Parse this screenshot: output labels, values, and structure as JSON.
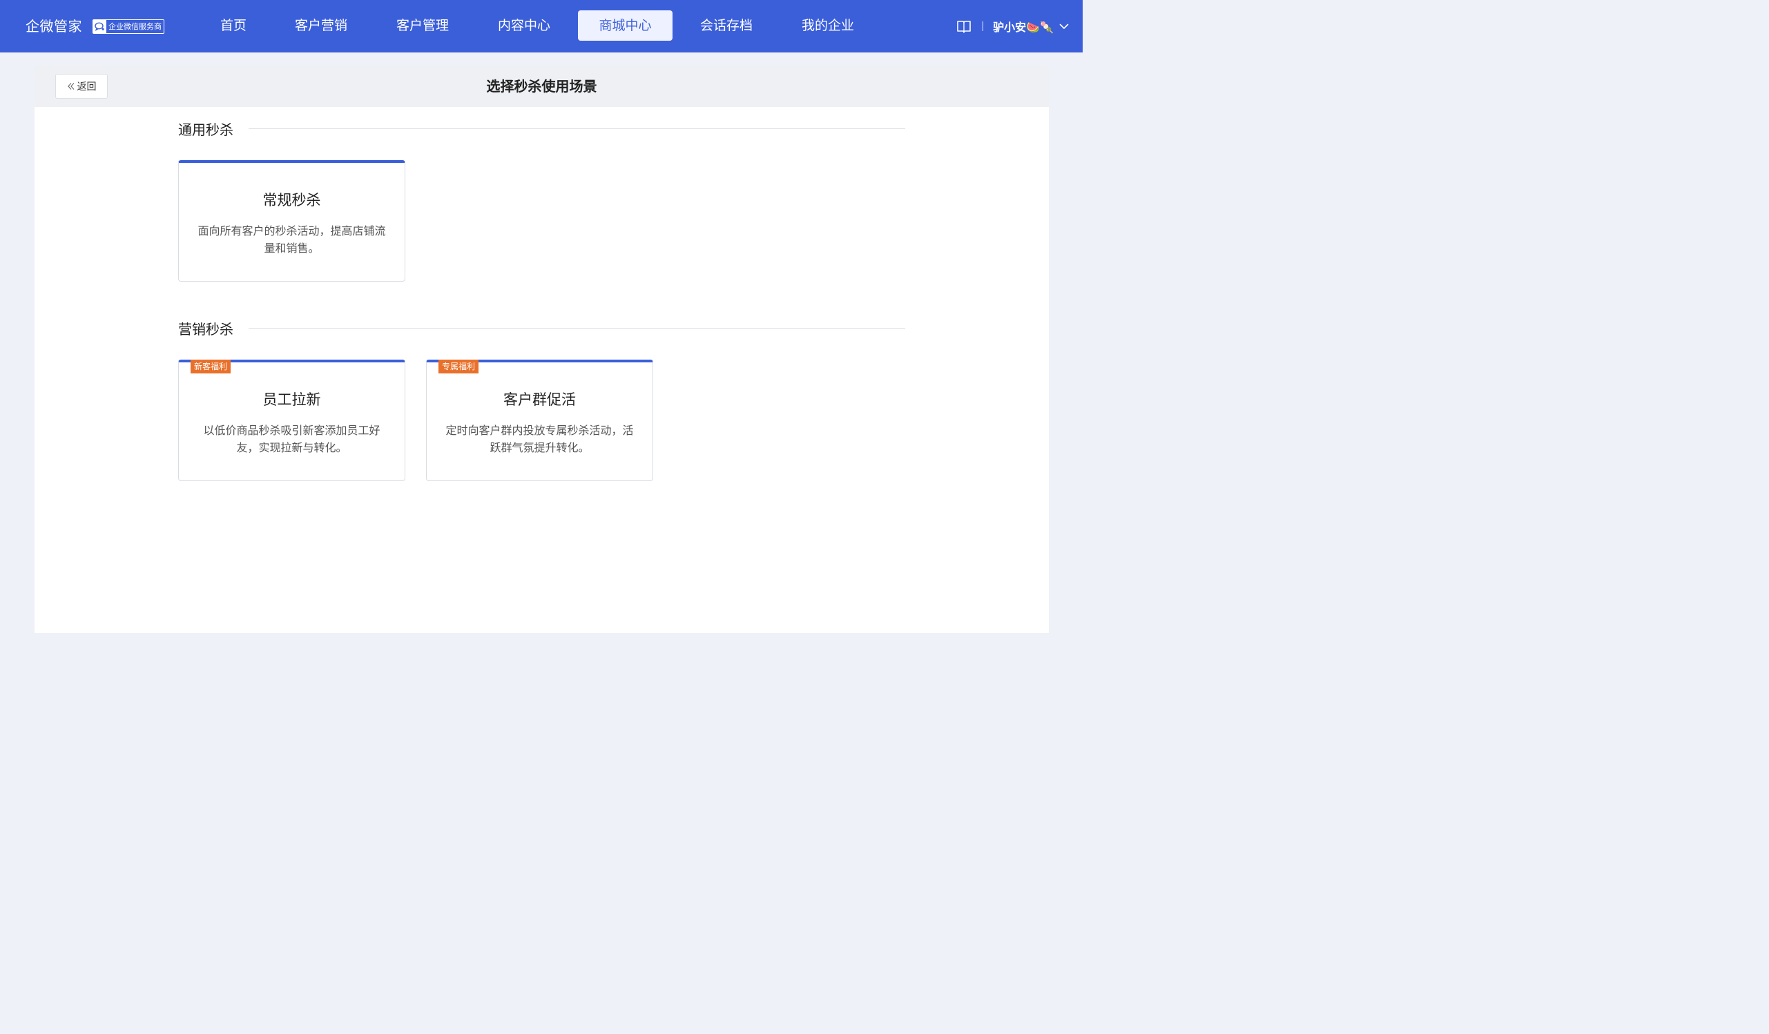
{
  "header": {
    "brand_name": "企微管家",
    "brand_badge": "企业微信服务商",
    "nav": [
      {
        "label": "首页",
        "active": false
      },
      {
        "label": "客户营销",
        "active": false
      },
      {
        "label": "客户管理",
        "active": false
      },
      {
        "label": "内容中心",
        "active": false
      },
      {
        "label": "商城中心",
        "active": true
      },
      {
        "label": "会话存档",
        "active": false
      },
      {
        "label": "我的企业",
        "active": false
      }
    ],
    "user_name": "驴小安🍉🍡"
  },
  "page": {
    "back_label": "返回",
    "title": "选择秒杀使用场景"
  },
  "sections": [
    {
      "title": "通用秒杀",
      "cards": [
        {
          "tag": "",
          "title": "常规秒杀",
          "desc": "面向所有客户的秒杀活动，提高店铺流量和销售。"
        }
      ]
    },
    {
      "title": "营销秒杀",
      "cards": [
        {
          "tag": "新客福利",
          "title": "员工拉新",
          "desc": "以低价商品秒杀吸引新客添加员工好友，实现拉新与转化。"
        },
        {
          "tag": "专属福利",
          "title": "客户群促活",
          "desc": "定时向客户群内投放专属秒杀活动，活跃群气氛提升转化。"
        }
      ]
    }
  ],
  "colors": {
    "primary": "#3b5fd9",
    "tag": "#e8702a",
    "page_bg": "#eef1f8"
  }
}
